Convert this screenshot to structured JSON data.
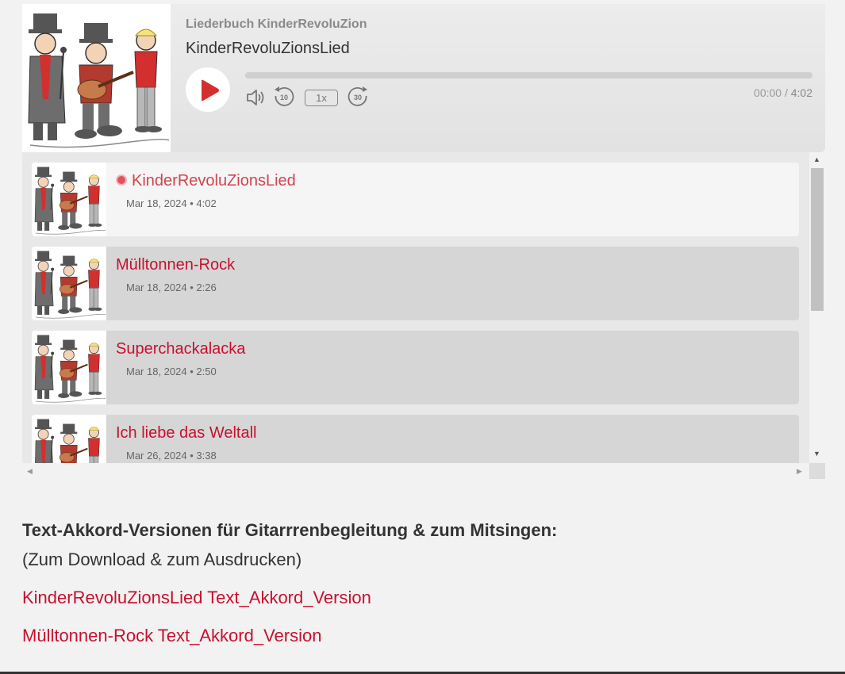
{
  "player": {
    "podcast_title": "Liederbuch KinderRevoluZion",
    "episode_title": "KinderRevoluZionsLied",
    "speed": "1x",
    "skip_back_label": "10",
    "skip_forward_label": "30",
    "time_current": "00:00",
    "time_separator": "/",
    "time_total": "4:02",
    "progress": 0,
    "accent_color": "#d32f2f"
  },
  "episodes": [
    {
      "title": "KinderRevoluZionsLied",
      "meta": "Mar 18, 2024 • 4:02",
      "active": true
    },
    {
      "title": "Mülltonnen-Rock",
      "meta": "Mar 18, 2024 • 2:26",
      "active": false
    },
    {
      "title": "Superchackalacka",
      "meta": "Mar 18, 2024 • 2:50",
      "active": false
    },
    {
      "title": "Ich liebe das Weltall",
      "meta": "Mar 26, 2024 • 3:38",
      "active": false
    }
  ],
  "content": {
    "heading": "Text-Akkord-Versionen für Gitarrrenbegleitung & zum Mitsingen:",
    "subheading": "(Zum Download & zum Ausdrucken)",
    "links": [
      "KinderRevoluZionsLied Text_Akkord_Version",
      "Mülltonnen-Rock Text_Akkord_Version"
    ]
  },
  "icons": {
    "play": "play-icon",
    "volume": "volume-icon",
    "rewind": "rewind-10-icon",
    "forward": "forward-30-icon",
    "now_playing": "now-playing-dot-icon"
  }
}
